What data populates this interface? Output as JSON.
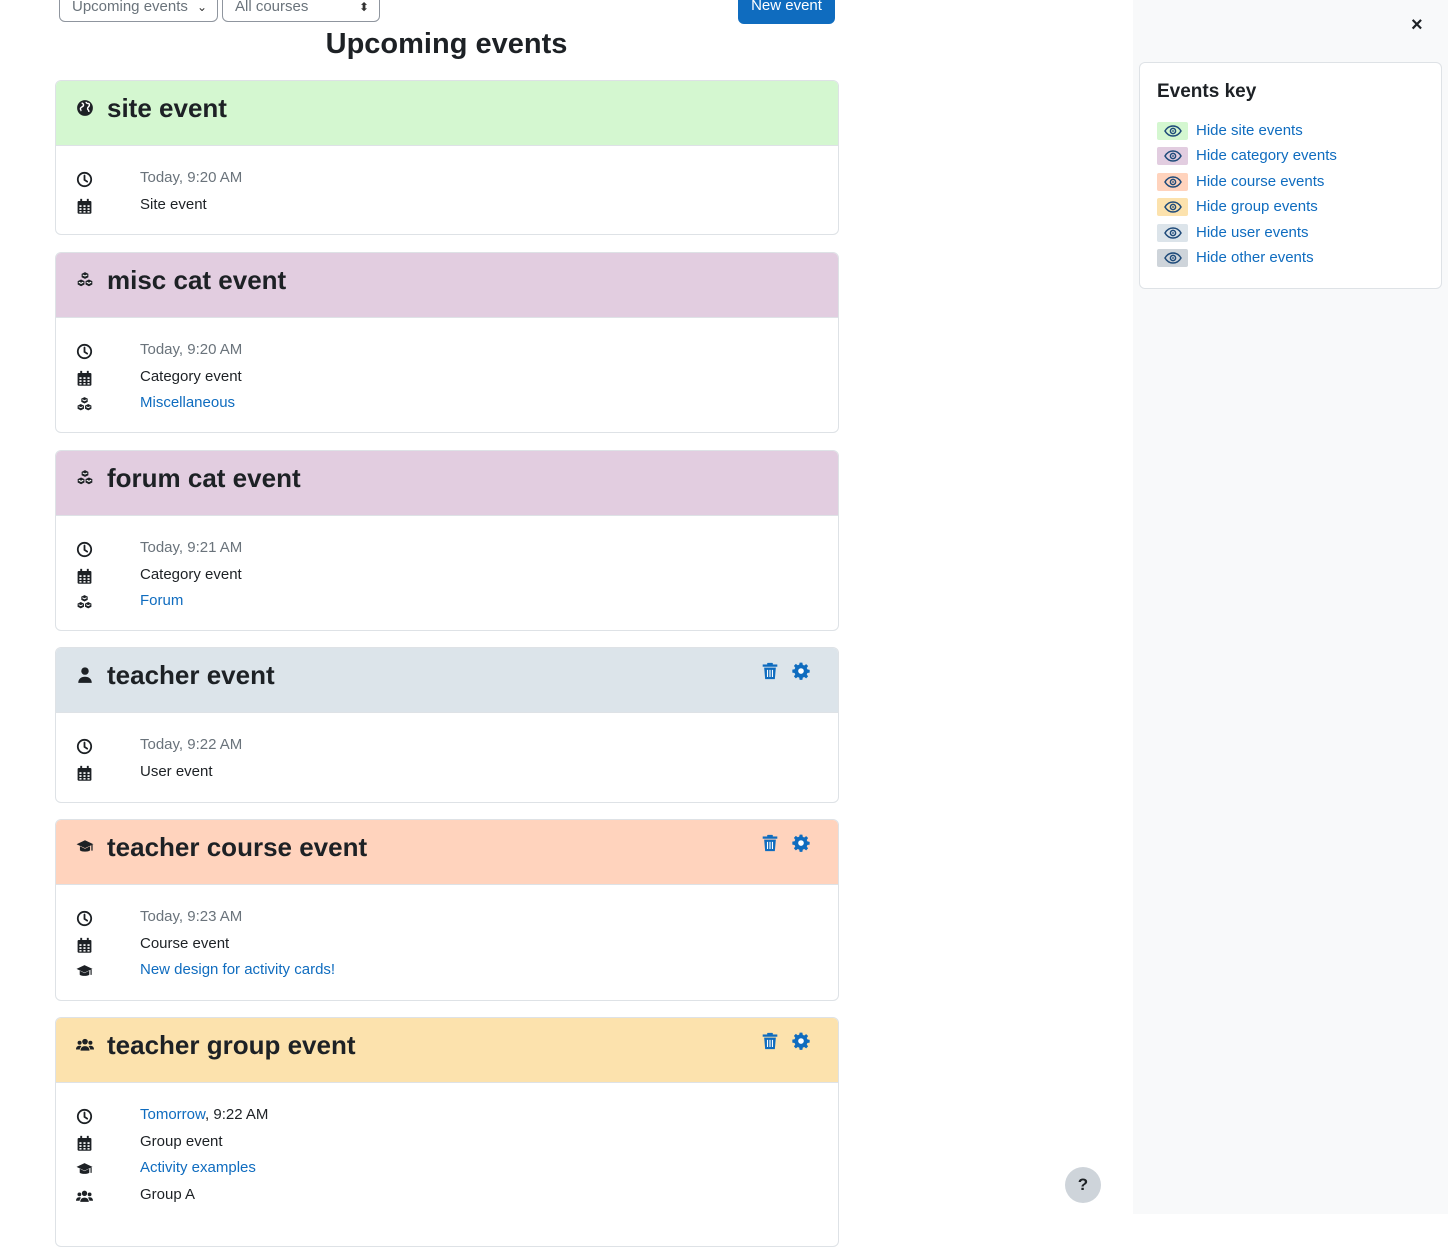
{
  "toolbar": {
    "view_select": "Upcoming events",
    "course_select": "All courses",
    "new_event": "New event"
  },
  "page_title": "Upcoming events",
  "events": [
    {
      "title": "site event",
      "type": "site",
      "header_color": "#d4f7d0",
      "time": "Today, 9:20 AM",
      "event_type": "Site event"
    },
    {
      "title": "misc cat event",
      "type": "category",
      "header_color": "#e2cde0",
      "time": "Today, 9:20 AM",
      "event_type": "Category event",
      "category": "Miscellaneous"
    },
    {
      "title": "forum cat event",
      "type": "category",
      "header_color": "#e2cde0",
      "time": "Today, 9:21 AM",
      "event_type": "Category event",
      "category": "Forum"
    },
    {
      "title": "teacher event",
      "type": "user",
      "header_color": "#dce4ea",
      "time": "Today, 9:22 AM",
      "event_type": "User event"
    },
    {
      "title": "teacher course event",
      "type": "course",
      "header_color": "#ffd3bd",
      "time": "Today, 9:23 AM",
      "event_type": "Course event",
      "course": "New design for activity cards!"
    },
    {
      "title": "teacher group event",
      "type": "group",
      "header_color": "#fce2ad",
      "time_link": "Tomorrow",
      "time_rest": ", 9:22 AM",
      "event_type": "Group event",
      "course": "Activity examples",
      "group": "Group A"
    }
  ],
  "events_key": {
    "title": "Events key",
    "items": [
      {
        "label": "Hide site events",
        "color": "#d4f7d0"
      },
      {
        "label": "Hide category events",
        "color": "#e2cde0"
      },
      {
        "label": "Hide course events",
        "color": "#ffd3bd"
      },
      {
        "label": "Hide group events",
        "color": "#fce2ad"
      },
      {
        "label": "Hide user events",
        "color": "#dce4ea"
      },
      {
        "label": "Hide other events",
        "color": "#ced4da"
      }
    ]
  },
  "close_label": "×",
  "help_label": "?",
  "icons": {
    "site": "globe-icon",
    "category": "cubes-icon",
    "user": "user-icon",
    "course": "graduation-cap-icon",
    "group": "users-icon",
    "time": "clock-icon",
    "event_type": "calendar-icon",
    "delete": "trash-icon",
    "edit": "gear-icon",
    "visibility": "eye-icon"
  }
}
